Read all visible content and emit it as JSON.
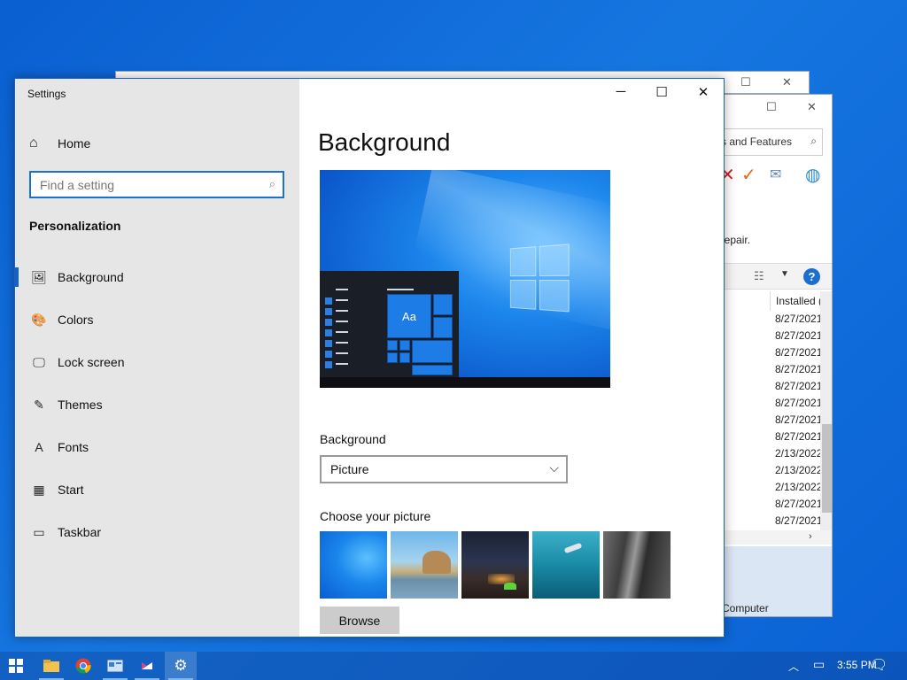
{
  "background_windows": {
    "back_controls": {
      "maximize": "☐",
      "close": "✕"
    },
    "programs": {
      "controls": {
        "maximize": "☐",
        "close": "✕"
      },
      "search_text": "s and Features",
      "repair_text": "Repair.",
      "column_header": "Installed (",
      "dates": [
        "8/27/2021",
        "8/27/2021",
        "8/27/2021",
        "8/27/2021",
        "8/27/2021",
        "8/27/2021",
        "8/27/2021",
        "8/27/2021",
        "2/13/2022",
        "2/13/2022",
        "2/13/2022",
        "8/27/2021",
        "8/27/2021"
      ],
      "status_text": "Computer",
      "help_glyph": "?",
      "scroll_right": "›"
    }
  },
  "settings": {
    "window_title": "Settings",
    "controls": {
      "minimize": "─",
      "maximize": "☐",
      "close": "✕"
    },
    "home_label": "Home",
    "search_placeholder": "Find a setting",
    "section_title": "Personalization",
    "nav": [
      {
        "label": "Background",
        "icon": "image-icon",
        "glyph": "🖼"
      },
      {
        "label": "Colors",
        "icon": "palette-icon",
        "glyph": "🎨"
      },
      {
        "label": "Lock screen",
        "icon": "lock-screen-icon",
        "glyph": "🖵"
      },
      {
        "label": "Themes",
        "icon": "brush-icon",
        "glyph": "✎"
      },
      {
        "label": "Fonts",
        "icon": "font-icon",
        "glyph": "A"
      },
      {
        "label": "Start",
        "icon": "start-tiles-icon",
        "glyph": "▦"
      },
      {
        "label": "Taskbar",
        "icon": "taskbar-icon",
        "glyph": "▭"
      }
    ],
    "active_nav": "Background",
    "page_title": "Background",
    "preview_tile_text": "Aa",
    "background_label": "Background",
    "background_value": "Picture",
    "choose_label": "Choose your picture",
    "browse_label": "Browse"
  },
  "taskbar": {
    "apps": [
      "start-button",
      "file-explorer",
      "chrome",
      "control-panel",
      "visual-studio",
      "settings"
    ],
    "active_app": "settings",
    "time": "3:55 PM"
  },
  "colors": {
    "accent": "#1a62c0",
    "desktop": "#1676e0"
  }
}
